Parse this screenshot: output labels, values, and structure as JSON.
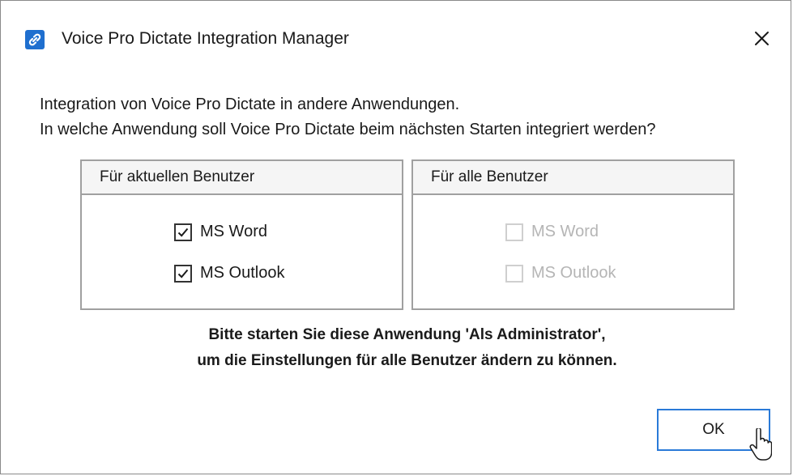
{
  "window": {
    "title": "Voice Pro Dictate Integration Manager",
    "app_icon": "link-icon",
    "close_icon": "close-icon"
  },
  "intro": {
    "line1": "Integration von Voice Pro Dictate in andere Anwendungen.",
    "line2": "In welche Anwendung soll Voice Pro Dictate beim nächsten Starten integriert werden?"
  },
  "groups": {
    "current_user": {
      "header": "Für aktuellen Benutzer",
      "items": [
        {
          "label": "MS Word",
          "checked": true,
          "enabled": true
        },
        {
          "label": "MS Outlook",
          "checked": true,
          "enabled": true
        }
      ]
    },
    "all_users": {
      "header": "Für alle Benutzer",
      "items": [
        {
          "label": "MS Word",
          "checked": false,
          "enabled": false
        },
        {
          "label": "MS Outlook",
          "checked": false,
          "enabled": false
        }
      ]
    }
  },
  "notice": {
    "line1": "Bitte starten Sie diese Anwendung 'Als Administrator',",
    "line2": "um die Einstellungen für alle Benutzer ändern zu können."
  },
  "buttons": {
    "ok_label": "OK"
  },
  "colors": {
    "accent": "#2a7ad8",
    "icon_bg": "#1f6fcf",
    "disabled_text": "#b5b5b5",
    "group_border": "#a0a0a0"
  }
}
